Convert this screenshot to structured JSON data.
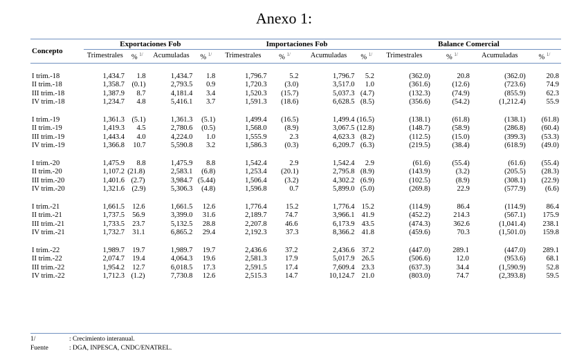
{
  "title": "Anexo 1:",
  "headers": {
    "concept": "Concepto",
    "groups": [
      "Exportaciones Fob",
      "Importaciones Fob",
      "Balance Comercial"
    ],
    "sub": [
      "Trimestrales",
      "%",
      "Acumuladas",
      "%"
    ],
    "sup": "1/"
  },
  "blocks": [
    [
      {
        "label": "I trim.-18",
        "v": [
          "1,434.7",
          "1.8",
          "1,434.7",
          "1.8",
          "1,796.7",
          "5.2",
          "1,796.7",
          "5.2",
          "(362.0)",
          "20.8",
          "(362.0)",
          "20.8"
        ],
        "m": []
      },
      {
        "label": "II trim.-18",
        "v": [
          "1,358.7",
          "(0.1)",
          "2,793.5",
          "0.9",
          "1,720.3",
          "(3.0)",
          "3,517.0",
          "1.0",
          "(361.6)",
          "(12.6)",
          "(723.6)",
          "74.9"
        ],
        "m": []
      },
      {
        "label": "III trim.-18",
        "v": [
          "1,387.9",
          "8.7",
          "4,181.4",
          "3.4",
          "1,520.3",
          "(15.7)",
          "5,037.3",
          "(4.7)",
          "(132.3)",
          "(74.9)",
          "(855.9)",
          "62.3"
        ],
        "m": []
      },
      {
        "label": "IV trim.-18",
        "v": [
          "1,234.7",
          "4.8",
          "5,416.1",
          "3.7",
          "1,591.3",
          "(18.6)",
          "6,628.5",
          "(8.5)",
          "(356.6)",
          "(54.2)",
          "(1,212.4)",
          "55.9"
        ],
        "m": []
      }
    ],
    [
      {
        "label": "I trim.-19",
        "v": [
          "1,361.3",
          "(5.1)",
          "1,361.3",
          "(5.1)",
          "1,499.4",
          "(16.5)",
          "1,499.4",
          "(16.5)",
          "(138.1)",
          "(61.8)",
          "(138.1)",
          "(61.8)"
        ],
        "m": []
      },
      {
        "label": "II trim.-19",
        "v": [
          "1,419.3",
          "4.5",
          "2,780.6",
          "(0.5)",
          "1,568.0",
          "(8.9)",
          "3,067.5",
          "(12.8)",
          "(148.7)",
          "(58.9)",
          "(286.8)",
          "(60.4)"
        ],
        "m": []
      },
      {
        "label": "III trim.-19",
        "v": [
          "1,443.4",
          "4.0",
          "4,224.0",
          "1.0",
          "1,555.9",
          "2.3",
          "4,623.3",
          "(8.2)",
          "(112.5)",
          "(15.0)",
          "(399.3)",
          "(53.3)"
        ],
        "m": []
      },
      {
        "label": "IV trim.-19",
        "v": [
          "1,366.8",
          "10.7",
          "5,590.8",
          "3.2",
          "1,586.3",
          "(0.3)",
          "6,209.7",
          "(6.3)",
          "(219.5)",
          "(38.4)",
          "(618.9)",
          "(49.0)"
        ],
        "m": []
      }
    ],
    [
      {
        "label": "I trim.-20",
        "v": [
          "1,475.9",
          "8.8",
          "1,475.9",
          "8.8",
          "1,542.4",
          "2.9",
          "1,542.4",
          "2.9",
          "(61.6)",
          "(55.4)",
          "(61.6)",
          "(55.4)"
        ],
        "m": []
      },
      {
        "label": "II trim.-20",
        "v": [
          "1,107.2",
          "(21.8)",
          "2,583.1",
          "(6.8)",
          "1,253.4",
          "(20.1)",
          "2,795.8",
          "(8.9)",
          "(143.9)",
          "(3.2)",
          "(205.5)",
          "(28.3)"
        ],
        "m": [
          1
        ]
      },
      {
        "label": "III trim.-20",
        "v": [
          "1,401.6",
          "(2.7)",
          "3,984.7",
          "(5.44)",
          "1,506.4",
          "(3.2)",
          "4,302.2",
          "(6.9)",
          "(102.5)",
          "(8.9)",
          "(308.1)",
          "(22.9)"
        ],
        "m": [
          1
        ]
      },
      {
        "label": "IV trim.-20",
        "v": [
          "1,321.6",
          "(2.9)",
          "5,306.3",
          "(4.8)",
          "1,596.8",
          "0.7",
          "5,899.0",
          "(5.0)",
          "(269.8)",
          "22.9",
          "(577.9)",
          "(6.6)"
        ],
        "m": []
      }
    ],
    [
      {
        "label": "I trim.-21",
        "v": [
          "1,661.5",
          "12.6",
          "1,661.5",
          "12.6",
          "1,776.4",
          "15.2",
          "1,776.4",
          "15.2",
          "(114.9)",
          "86.4",
          "(114.9)",
          "86.4"
        ],
        "m": [
          1
        ]
      },
      {
        "label": "II trim.-21",
        "v": [
          "1,737.5",
          "56.9",
          "3,399.0",
          "31.6",
          "2,189.7",
          "74.7",
          "3,966.1",
          "41.9",
          "(452.2)",
          "214.3",
          "(567.1)",
          "175.9"
        ],
        "m": [
          1,
          5
        ]
      },
      {
        "label": "III trim.-21",
        "v": [
          "1,733.5",
          "23.7",
          "5,132.5",
          "28.8",
          "2,207.8",
          "46.6",
          "6,173.9",
          "43.5",
          "(474.3)",
          "362.6",
          "(1,041.4)",
          "238.1"
        ],
        "m": [
          1,
          5
        ]
      },
      {
        "label": "IV trim.-21",
        "v": [
          "1,732.7",
          "31.1",
          "6,865.2",
          "29.4",
          "2,192.3",
          "37.3",
          "8,366.2",
          "41.8",
          "(459.6)",
          "70.3",
          "(1,501.0)",
          "159.8"
        ],
        "m": [
          1
        ]
      }
    ],
    [
      {
        "label": "I trim.-22",
        "v": [
          "1,989.7",
          "19.7",
          "1,989.7",
          "19.7",
          "2,436.6",
          "37.2",
          "2,436.6",
          "37.2",
          "(447.0)",
          "289.1",
          "(447.0)",
          "289.1"
        ],
        "m": [
          1,
          5,
          9
        ]
      },
      {
        "label": "II trim.-22",
        "v": [
          "2,074.7",
          "19.4",
          "4,064.3",
          "19.6",
          "2,581.3",
          "17.9",
          "5,017.9",
          "26.5",
          "(506.6)",
          "12.0",
          "(953.6)",
          "68.1"
        ],
        "m": [
          1,
          5,
          9
        ]
      },
      {
        "label": "III trim.-22",
        "v": [
          "1,954.2",
          "12.7",
          "6,018.5",
          "17.3",
          "2,591.5",
          "17.4",
          "7,609.4",
          "23.3",
          "(637.3)",
          "34.4",
          "(1,590.9)",
          "52.8"
        ],
        "m": [
          1,
          5,
          9
        ]
      },
      {
        "label": "IV trim.-22",
        "v": [
          "1,712.3",
          "(1.2)",
          "7,730.8",
          "12.6",
          "2,515.3",
          "14.7",
          "10,124.7",
          "21.0",
          "(803.0)",
          "74.7",
          "(2,393.8)",
          "59.5"
        ],
        "m": [
          1,
          5,
          9
        ]
      }
    ]
  ],
  "notes": [
    {
      "key": "1/",
      "text": ": Crecimiento interanual."
    },
    {
      "key": "Fuente",
      "text": ": DGA, INPESCA, CNDC/ENATREL."
    }
  ],
  "colors": {
    "rule": "#6f8fbf",
    "marker": "#2e7d32"
  }
}
